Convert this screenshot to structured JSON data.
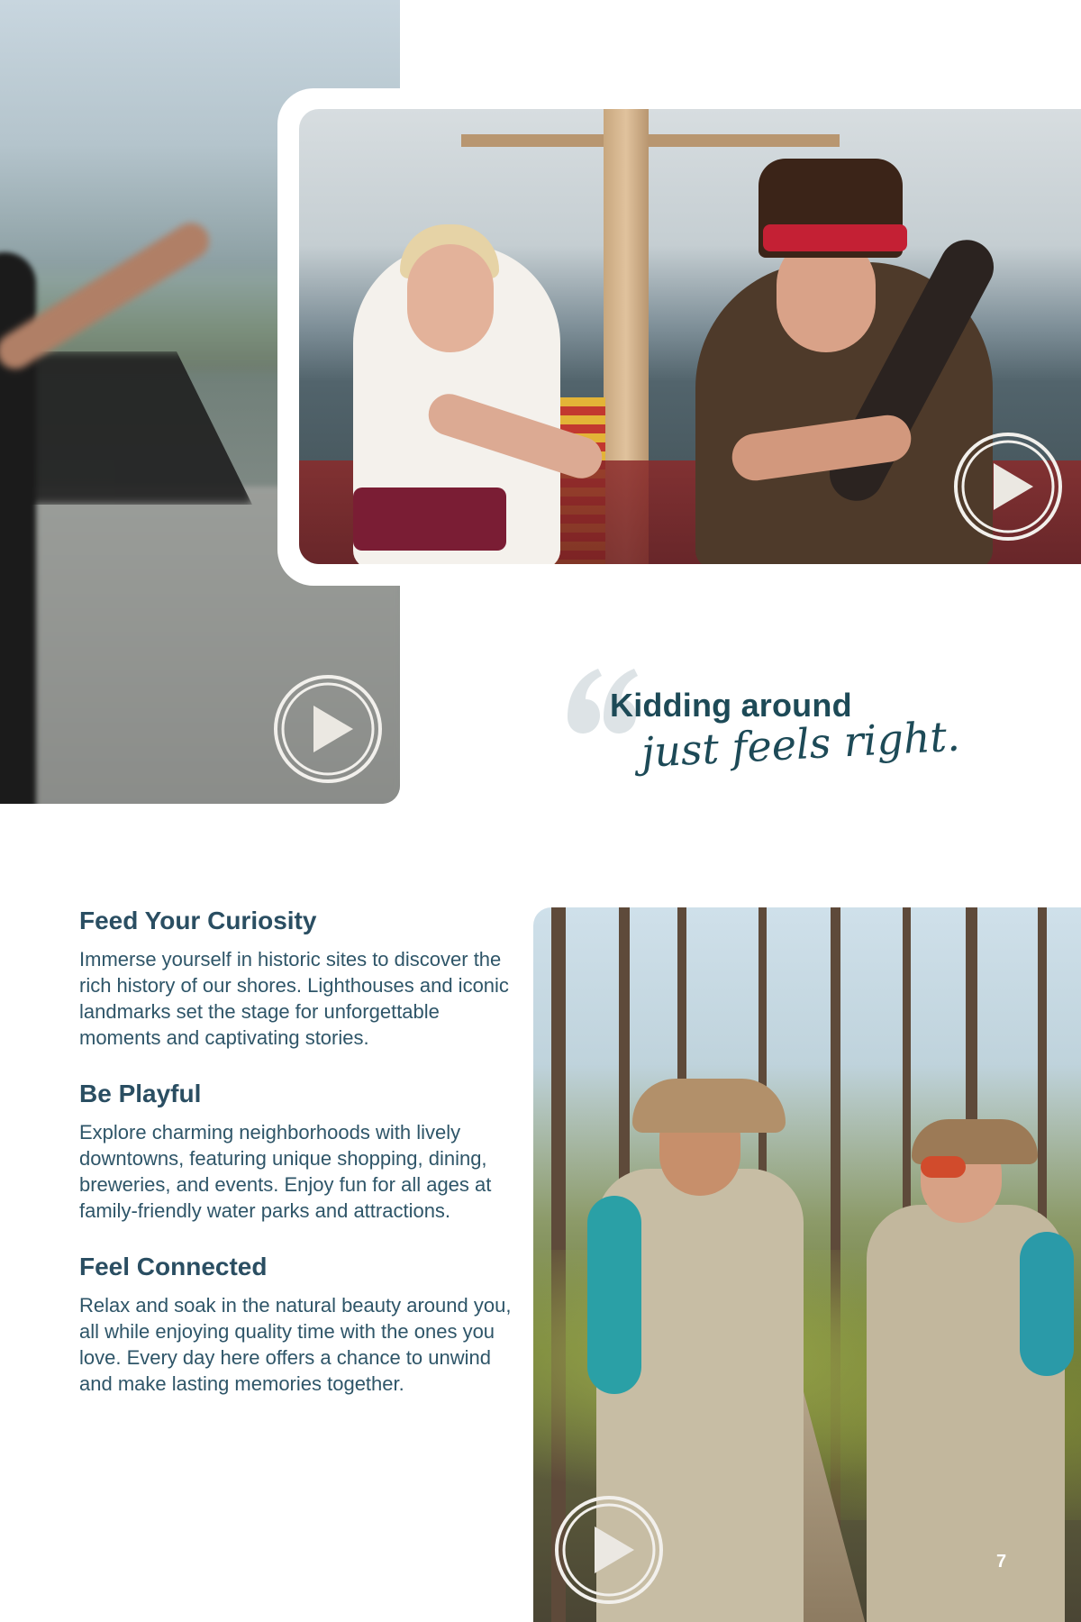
{
  "videos": {
    "left": {
      "name": "Blurred pointing scene"
    },
    "pirate": {
      "name": "Pirate ship scene"
    },
    "forest": {
      "name": "Forest boardwalk scene"
    }
  },
  "quote": {
    "line1": "Kidding around",
    "line2": "just feels right."
  },
  "sections": [
    {
      "heading": "Feed Your Curiosity",
      "body": "Immerse yourself in historic sites to discover the rich history of our shores. Lighthouses and iconic landmarks set the stage for unforgettable moments and captivating stories."
    },
    {
      "heading": "Be Playful",
      "body": "Explore charming neighborhoods with lively downtowns, featuring unique shopping, dining, breweries, and events. Enjoy fun for all ages at family-friendly water parks and attractions."
    },
    {
      "heading": "Feel Connected",
      "body": "Relax and soak in the natural beauty around you, all while enjoying quality time with the ones you love. Every day here offers a chance to unwind and make lasting memories together."
    }
  ],
  "page_number": "7",
  "icons": {
    "play": "play-icon",
    "quote": "quote-mark-icon"
  },
  "colors": {
    "heading": "#2a4e62",
    "body": "#2e5568",
    "quote": "#1d4a57",
    "quote_mark": "#dde3e6"
  }
}
